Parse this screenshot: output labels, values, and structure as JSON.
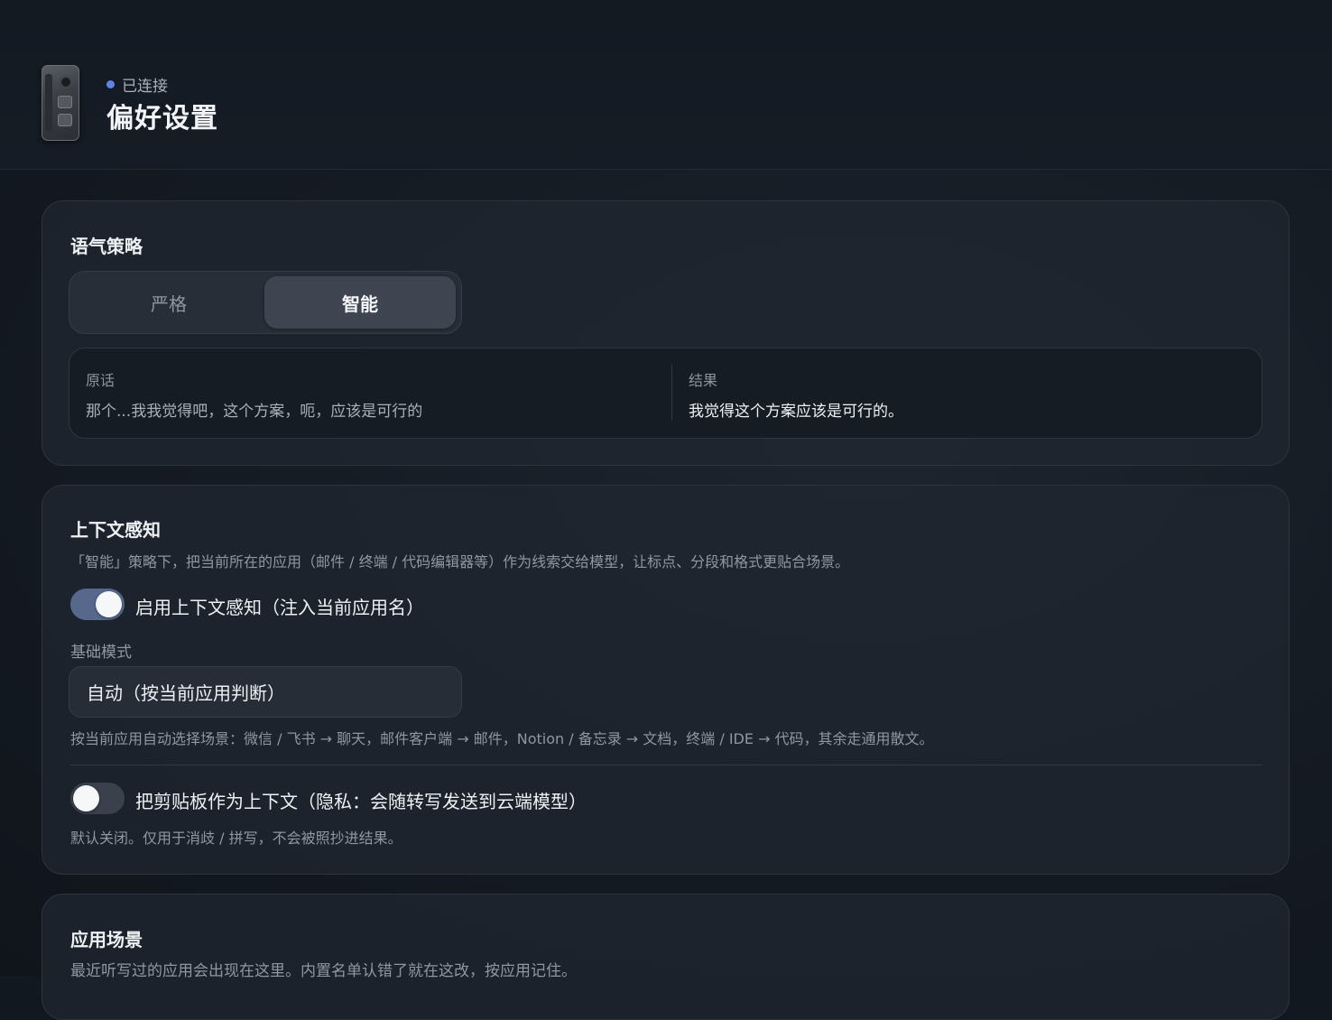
{
  "header": {
    "status": "已连接",
    "title": "偏好设置"
  },
  "tone": {
    "title": "语气策略",
    "options": [
      "严格",
      "智能"
    ],
    "selected": "智能",
    "compare": {
      "original_label": "原话",
      "original_text": "那个...我我觉得吧，这个方案，呃，应该是可行的",
      "result_label": "结果",
      "result_text": "我觉得这个方案应该是可行的。"
    }
  },
  "context": {
    "title": "上下文感知",
    "description": "「智能」策略下，把当前所在的应用（邮件 / 终端 / 代码编辑器等）作为线索交给模型，让标点、分段和格式更贴合场景。",
    "enable_toggle": {
      "label": "启用上下文感知（注入当前应用名）",
      "on": true
    },
    "mode_label": "基础模式",
    "mode_value": "自动（按当前应用判断）",
    "mode_hint": "按当前应用自动选择场景：微信 / 飞书 → 聊天，邮件客户端 → 邮件，Notion / 备忘录 → 文档，终端 / IDE → 代码，其余走通用散文。",
    "clipboard_toggle": {
      "label": "把剪贴板作为上下文（隐私：会随转写发送到云端模型）",
      "on": false
    },
    "clipboard_hint": "默认关闭。仅用于消歧 / 拼写，不会被照抄进结果。"
  },
  "scenes": {
    "title": "应用场景",
    "description": "最近听写过的应用会出现在这里。内置名单认错了就在这改，按应用记住。"
  }
}
